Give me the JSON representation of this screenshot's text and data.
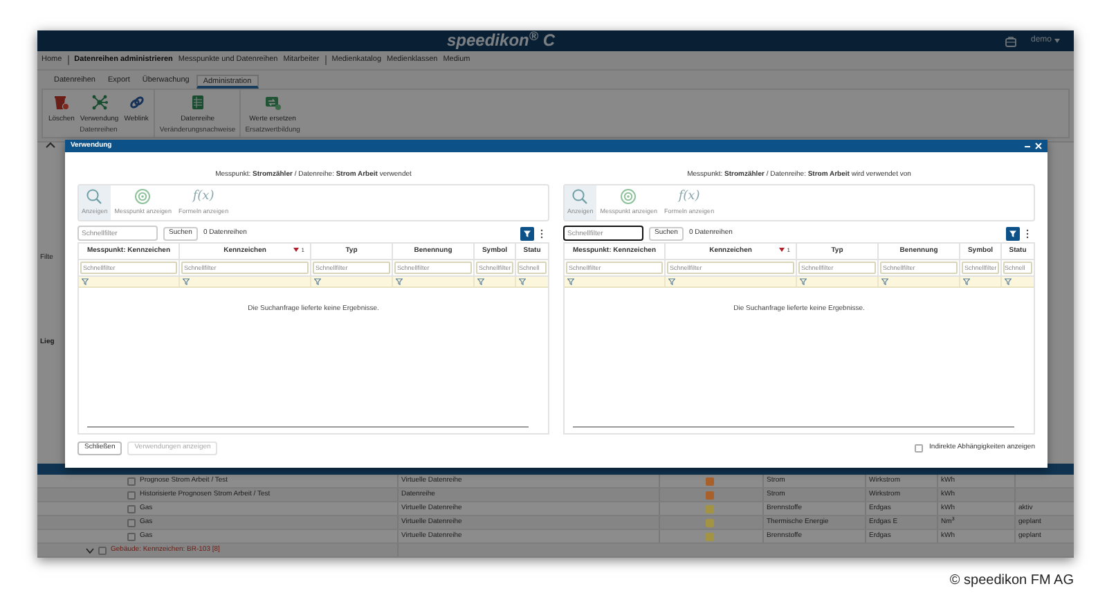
{
  "header": {
    "title": "speedikon$^{®}$ C",
    "user": "demo"
  },
  "nav": [
    {
      "label": "Home",
      "selected": false
    },
    {
      "label": "Datenreihen administrieren",
      "selected": true
    },
    {
      "label": "Messpunkte und Datenreihen",
      "selected": false
    },
    {
      "label": "Mitarbeiter",
      "selected": false
    },
    {
      "label": "Medienkatalog",
      "selected": false
    },
    {
      "label": "Medienklassen",
      "selected": false
    },
    {
      "label": "Medium",
      "selected": false
    }
  ],
  "ribbon": {
    "tabs": [
      {
        "label": "Datenreihen",
        "selected": false
      },
      {
        "label": "Export",
        "selected": false
      },
      {
        "label": "Überwachung",
        "selected": false
      },
      {
        "label": "Administration",
        "selected": true
      }
    ],
    "groups": [
      {
        "label": "Datenreihen",
        "buttons": [
          {
            "label": "Löschen",
            "kind": "trash"
          },
          {
            "label": "Verwendung",
            "kind": "network"
          },
          {
            "label": "Weblink",
            "kind": "link"
          }
        ]
      },
      {
        "label": "Veränderungsnachweise",
        "buttons": [
          {
            "label": "Datenreihe",
            "kind": "sheet"
          }
        ]
      },
      {
        "label": "Ersatzwertbildung",
        "buttons": [
          {
            "label": "Werte ersetzen",
            "kind": "replace"
          }
        ]
      }
    ]
  },
  "background": {
    "side_labels": [
      "Filte",
      "Lieg"
    ],
    "rows": [
      {
        "kind": "item",
        "checked": false,
        "name": "Prognose Strom Arbeit / Test",
        "type": "Virtuelle Datenreihe",
        "color": "#a8612a",
        "category": "Strom",
        "subtype": "Wirkstrom",
        "unit": "kWh"
      },
      {
        "kind": "item",
        "checked": false,
        "name": "Historisierte Prognosen Strom Arbeit / Test",
        "type": "Datenreihe",
        "color": "#a8612a",
        "category": "Strom",
        "subtype": "Wirkstrom",
        "unit": "kWh"
      },
      {
        "kind": "item",
        "checked": false,
        "name": "Gas",
        "type": "Virtuelle Datenreihe",
        "color": "#a39443",
        "category": "Brennstoffe",
        "subtype": "Erdgas",
        "unit": "kWh",
        "status": "aktiv"
      },
      {
        "kind": "item",
        "checked": false,
        "name": "Gas",
        "type": "Virtuelle Datenreihe",
        "color": "#a39443",
        "category": "Thermische Energie",
        "subtype": "Erdgas E",
        "unit": "Nm$^{3}$",
        "status": "geplant"
      },
      {
        "kind": "item",
        "checked": false,
        "name": "Gas",
        "type": "Virtuelle Datenreihe",
        "color": "#a39443",
        "category": "Brennstoffe",
        "subtype": "Erdgas",
        "unit": "kWh",
        "status": "geplant"
      },
      {
        "kind": "group",
        "checked": false,
        "name": "Gebäude: Kennzeichen: BR-103 [8]",
        "expanded": true
      }
    ]
  },
  "dialog": {
    "title": "Verwendung",
    "panels": [
      {
        "caption": "Messpunkt: **Stromzähler** / Datenreihe: **Strom Arbeit** verwendet",
        "toolbar": [
          {
            "label": "Anzeigen",
            "kind": "search",
            "selected": true
          },
          {
            "label": "Messpunkt anzeigen",
            "kind": "target",
            "selected": false
          },
          {
            "label": "Formeln anzeigen",
            "kind": "formula",
            "glyph": "f(x)",
            "selected": false
          }
        ],
        "search": {
          "placeholder": "Schnellfilter",
          "focused": false
        },
        "search_button": "Suchen",
        "count": "0 Datenreihen",
        "columns": [
          {
            "label": "Messpunkt: Kennzeichen",
            "placeholder": "Schnellfilter"
          },
          {
            "label": "Kennzeichen",
            "placeholder": "Schnellfilter",
            "sort_descending": true,
            "sort_rank": "1"
          },
          {
            "label": "Typ",
            "placeholder": "Schnellfilter"
          },
          {
            "label": "Benennung",
            "placeholder": "Schnellfilter"
          },
          {
            "label": "Symbol",
            "placeholder": "Schnellfilter"
          },
          {
            "label": "Statu",
            "placeholder": "Schnell"
          }
        ],
        "empty_message": "Die Suchanfrage lieferte keine Ergebnisse."
      },
      {
        "caption": "Messpunkt: **Stromzähler** / Datenreihe: **Strom Arbeit** wird verwendet von",
        "toolbar": [
          {
            "label": "Anzeigen",
            "kind": "search",
            "selected": true
          },
          {
            "label": "Messpunkt anzeigen",
            "kind": "target",
            "selected": false
          },
          {
            "label": "Formeln anzeigen",
            "kind": "formula",
            "glyph": "f(x)",
            "selected": false
          }
        ],
        "search": {
          "placeholder": "Schnellfilter",
          "focused": true
        },
        "search_button": "Suchen",
        "count": "0 Datenreihen",
        "columns": [
          {
            "label": "Messpunkt: Kennzeichen",
            "placeholder": "Schnellfilter"
          },
          {
            "label": "Kennzeichen",
            "placeholder": "Schnellfilter",
            "sort_descending": true,
            "sort_rank": "1"
          },
          {
            "label": "Typ",
            "placeholder": "Schnellfilter"
          },
          {
            "label": "Benennung",
            "placeholder": "Schnellfilter"
          },
          {
            "label": "Symbol",
            "placeholder": "Schnellfilter"
          },
          {
            "label": "Statu",
            "placeholder": "Schnell"
          }
        ],
        "empty_message": "Die Suchanfrage lieferte keine Ergebnisse."
      }
    ],
    "buttons": [
      {
        "label": "Schließen",
        "disabled": false
      },
      {
        "label": "Verwendungen anzeigen",
        "disabled": true
      }
    ],
    "checkbox": {
      "label": "Indirekte Abhängigkeiten anzeigen",
      "checked": false
    }
  },
  "copyright": "© speedikon FM AG"
}
